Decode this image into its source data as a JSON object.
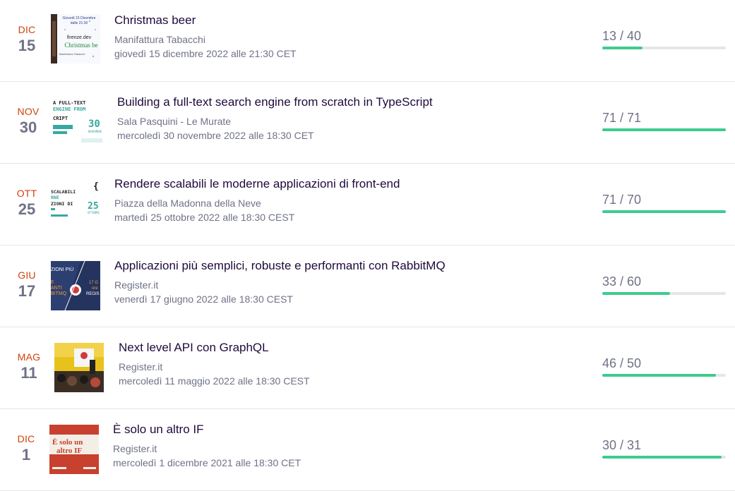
{
  "events": [
    {
      "month": "DIC",
      "day": "15",
      "title": "Christmas beer",
      "venue": "Manifattura Tabacchi",
      "when": "giovedì 15 dicembre 2022 alle 21:30 CET",
      "sold": "13 / 40",
      "fill_ratio": 0.325,
      "thumb_icon": "christmas-beer-poster",
      "thumb_text": [
        "Giovedì 15 Dicembre",
        "dalle 21:30",
        "firenze.dev",
        "Christmas be",
        "Manifattura Tabacchi"
      ]
    },
    {
      "month": "NOV",
      "day": "30",
      "title": "Building a full-text search engine from scratch in TypeScript",
      "venue": "Sala Pasquini - Le Murate",
      "when": "mercoledì 30 novembre 2022 alle 18:30 CET",
      "sold": "71 / 71",
      "fill_ratio": 1.0,
      "thumb_icon": "fulltext-search-poster",
      "thumb_text": [
        "A FULL-TEXT",
        "ENGINE FROM",
        "CRIPT",
        "30",
        "NOVEMBRE"
      ]
    },
    {
      "month": "OTT",
      "day": "25",
      "title": "Rendere scalabili le moderne applicazioni di front-end",
      "venue": "Piazza della Madonna della Neve",
      "when": "martedì 25 ottobre 2022 alle 18:30 CEST",
      "sold": "71 / 70",
      "fill_ratio": 1.0,
      "thumb_icon": "frontend-scalable-poster",
      "thumb_text": [
        "SCALABILI",
        "RNE",
        "ZIONI DI",
        "25",
        "OTTOBRE"
      ]
    },
    {
      "month": "GIU",
      "day": "17",
      "title": "Applicazioni più semplici, robuste e performanti con RabbitMQ",
      "venue": "Register.it",
      "when": "venerdì 17 giugno 2022 alle 18:30 CEST",
      "sold": "33 / 60",
      "fill_ratio": 0.55,
      "thumb_icon": "rabbitmq-poster",
      "thumb_text": [
        "ZIONI PIÙ",
        "E",
        "ANTI",
        "BITMQ",
        "17 G",
        "ore",
        "REGIS"
      ]
    },
    {
      "month": "MAG",
      "day": "11",
      "title": "Next level API con GraphQL",
      "venue": "Register.it",
      "when": "mercoledì 11 maggio 2022 alle 18:30 CEST",
      "sold": "46 / 50",
      "fill_ratio": 0.92,
      "thumb_icon": "graphql-talk-photo",
      "thumb_text": []
    },
    {
      "month": "DIC",
      "day": "1",
      "title": "È solo un altro IF",
      "venue": "Register.it",
      "when": "mercoledì 1 dicembre 2021 alle 18:30 CET",
      "sold": "30 / 31",
      "fill_ratio": 0.968,
      "thumb_icon": "altro-if-poster",
      "thumb_text": [
        "È solo un",
        "altro IF"
      ]
    }
  ],
  "colors": {
    "month": "#d1410c",
    "progress": "#3dcc8e",
    "track": "#e6e6ea",
    "muted": "#6f7287",
    "title": "#1e0a3c"
  }
}
